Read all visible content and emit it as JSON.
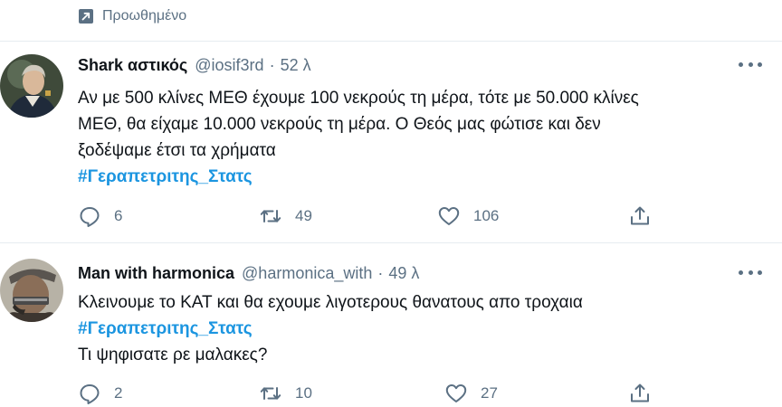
{
  "promoted": {
    "label": "Προωθημένο",
    "icon": "promoted-arrow-icon"
  },
  "colors": {
    "accent": "#1b95e0",
    "secondary_text": "#5b7083",
    "divider": "#e6ecf0"
  },
  "tweets": [
    {
      "name": "Shark αστικός",
      "handle": "@iosif3rd",
      "separator": "·",
      "time": "52 λ",
      "lines": [
        "Αν με 500 κλίνες ΜΕΘ έχουμε 100 νεκρούς τη μέρα, τότε με 50.000 κλίνες",
        "ΜΕΘ, θα είχαμε 10.000 νεκρούς τη μέρα. Ο Θεός μας φώτισε και δεν",
        "ξοδέψαμε έτσι τα χρήματα"
      ],
      "hashtag": "#Γεραπετριτης_Στατς",
      "replies": "6",
      "retweets": "49",
      "likes": "106"
    },
    {
      "name": "Man with harmonica",
      "handle": "@harmonica_with",
      "separator": "·",
      "time": "49 λ",
      "line1": "Κλεινουμε το ΚΑΤ και θα εχουμε λιγοτερους θανατους απο τροχαια",
      "hashtag": "#Γεραπετριτης_Στατς",
      "line2": "Τι ψηφισατε ρε μαλακες?",
      "replies": "2",
      "retweets": "10",
      "likes": "27"
    }
  ]
}
